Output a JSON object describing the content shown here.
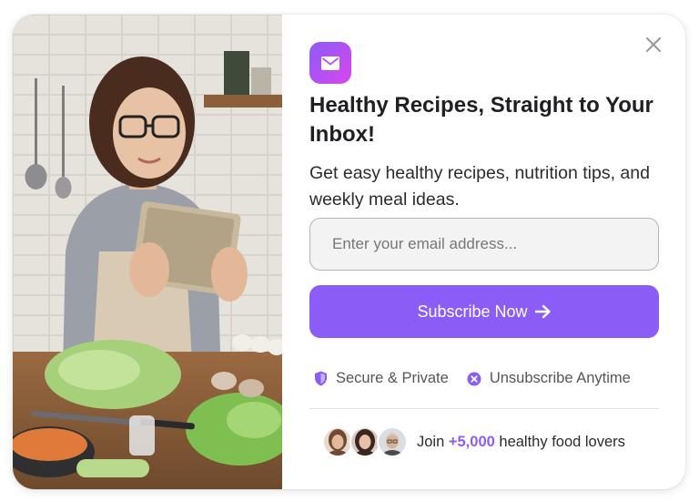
{
  "modal": {
    "title": "Healthy Recipes, Straight to Your Inbox!",
    "description": "Get easy healthy recipes, nutrition tips, and weekly meal ideas.",
    "email_input": {
      "value": "",
      "placeholder": "Enter your email address..."
    },
    "subscribe_button": {
      "label": "Subscribe Now",
      "icon": "arrow-right-icon"
    },
    "features": [
      {
        "icon": "shield-icon",
        "label": "Secure & Private"
      },
      {
        "icon": "x-circle-icon",
        "label": "Unsubscribe Anytime"
      }
    ],
    "social_proof": {
      "prefix": "Join",
      "count": "+5,000",
      "suffix": "healthy food lovers"
    },
    "close_icon": "close-icon",
    "badge_icon": "mail-icon",
    "image": "woman-with-tablet-in-kitchen-photo"
  },
  "colors": {
    "accent": "#8b5cf6",
    "badge_gradient_start": "#8b5cf6",
    "badge_gradient_end": "#d946ef",
    "text_primary": "#1f1f23",
    "text_secondary": "#55555c"
  }
}
